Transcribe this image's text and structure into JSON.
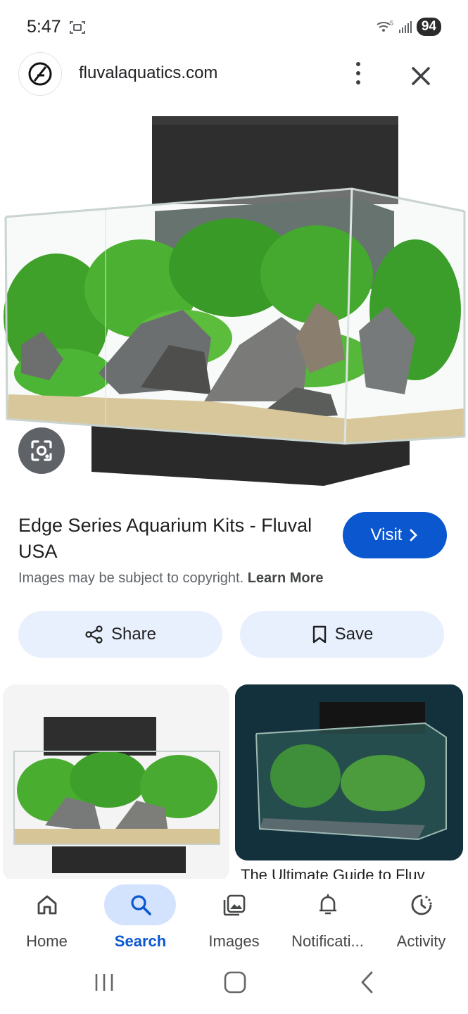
{
  "status_bar": {
    "time": "5:47",
    "battery": "94",
    "wifi_label": "5"
  },
  "header": {
    "site_name": "fluvalaquatics.com"
  },
  "result": {
    "title": "Edge Series Aquarium Kits - Fluval USA",
    "visit_label": "Visit",
    "copyright_text": "Images may be subject to copyright.",
    "learn_more": "Learn More",
    "share_label": "Share",
    "save_label": "Save"
  },
  "related": {
    "caption_2": "The Ultimate Guide to Fluv"
  },
  "bottom_nav": {
    "items": [
      {
        "label": "Home",
        "icon": "home-icon"
      },
      {
        "label": "Search",
        "icon": "search-icon"
      },
      {
        "label": "Images",
        "icon": "images-icon"
      },
      {
        "label": "Notificati...",
        "icon": "bell-icon"
      },
      {
        "label": "Activity",
        "icon": "activity-icon"
      }
    ],
    "active_index": 1
  },
  "colors": {
    "accent": "#0b57d0",
    "pill_bg": "#e8f0fe",
    "nav_active_bg": "#d3e3fd"
  }
}
